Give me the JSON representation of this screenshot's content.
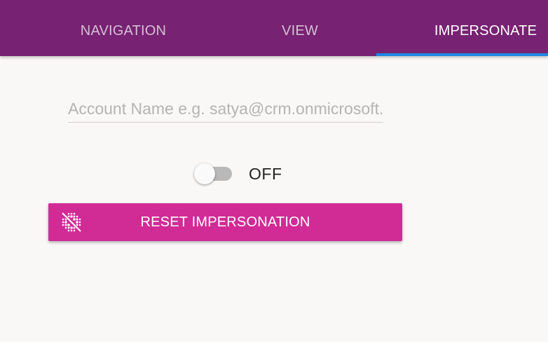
{
  "tabs": [
    {
      "label": "NAVIGATION",
      "active": false
    },
    {
      "label": "VIEW",
      "active": false
    },
    {
      "label": "IMPERSONATE",
      "active": true
    }
  ],
  "impersonate": {
    "account_placeholder": "Account Name e.g. satya@crm.onmicrosoft.com",
    "account_value": "",
    "toggle_state": "OFF",
    "reset_button_label": "RESET IMPERSONATION",
    "reset_icon": "impersonation-off-icon"
  },
  "colors": {
    "header": "#772272",
    "tab_indicator": "#1e88e5",
    "reset_button": "#d12b96",
    "background": "#faf8f6"
  }
}
